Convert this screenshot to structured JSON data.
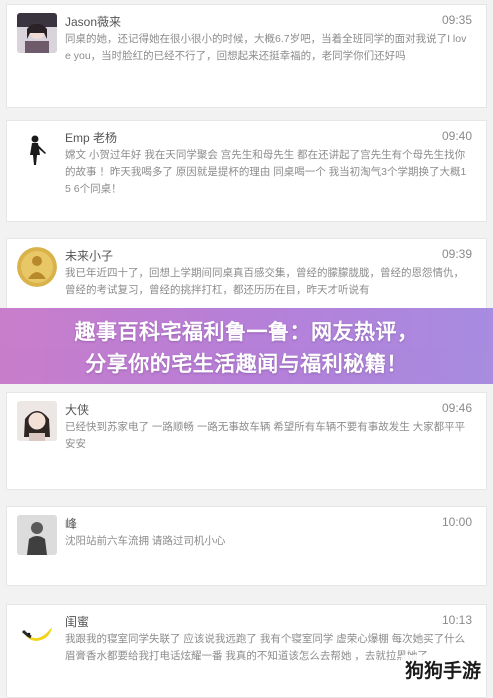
{
  "posts": [
    {
      "name": "Jason薇来",
      "time": "09:35",
      "text": "同桌的她，还记得她在很小很小的时候，大概6.7岁吧，当着全班同学的面对我说了I love you，当时脸红的已经不行了，回想起来还挺幸福的，老同学你们还好吗",
      "avatar_icon": "girl-photo-avatar"
    },
    {
      "name": "Emp 老杨",
      "time": "09:40",
      "text": "嫦文 小贺过年好 我在天同学聚会 宫先生和母先生 都在还讲起了宫先生有个母先生找你的故事 ！昨天我喝多了 原因就是提杯的理由 同桌喝一个 我当初淘气3个学期换了大概15 6个同桌！",
      "avatar_icon": "silhouette-avatar"
    },
    {
      "name": "未来小子",
      "time": "09:39",
      "text": "我已年近四十了，回想上学期间同桌真百感交集，曾经的朦朦胧胧，曾经的恩怨情仇，曾经的考试复习，曾经的挑拌打杠，都还历历在目，昨天才听说有",
      "avatar_icon": "golden-buddha-avatar"
    },
    {
      "name": "大侠",
      "time": "09:46",
      "text": "已经快到苏家电了 一路顺畅 一路无事故车辆 希望所有车辆不要有事故发生 大家都平平安安",
      "avatar_icon": "woman-photo-avatar"
    },
    {
      "name": "峰",
      "time": "10:00",
      "text": "沈阳站前六车流拥 请路过司机小心",
      "avatar_icon": "man-photo-avatar"
    },
    {
      "name": "闺蜜",
      "time": "10:13",
      "text": "我跟我的寝室同学失联了 应该说我远跑了 我有个寝室同学 虚荣心爆棚 每次她买了什么眉膏香水都要给我打电话炫耀一番 我真的不知道该怎么去帮她 ，去就拉黑她了",
      "avatar_icon": "banana-avatar"
    }
  ],
  "banner": {
    "line1": "趣事百科宅福利鲁一鲁：网友热评，",
    "line2": "分享你的宅生活趣闻与福利秘籍！"
  },
  "watermark": "狗狗手游"
}
